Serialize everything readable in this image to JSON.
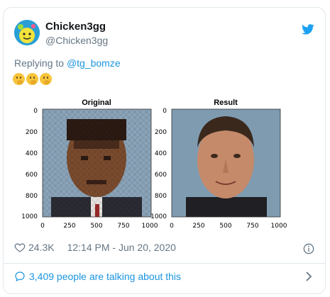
{
  "user": {
    "name": "Chicken3gg",
    "handle": "@Chicken3gg"
  },
  "reply": {
    "prefix": "Replying to ",
    "target": "@tg_bomze"
  },
  "emoji_count": 3,
  "figure": {
    "panels": [
      {
        "title": "Original",
        "xticks": [
          "0",
          "250",
          "500",
          "750",
          "1000"
        ],
        "yticks": [
          "0",
          "200",
          "400",
          "600",
          "800",
          "1000"
        ]
      },
      {
        "title": "Result",
        "xticks": [
          "0",
          "250",
          "500",
          "750",
          "1000"
        ],
        "yticks": [
          "0",
          "200",
          "400",
          "600",
          "800",
          "1000"
        ]
      }
    ]
  },
  "stats": {
    "likes": "24.3K",
    "timestamp": "12:14 PM - Jun 20, 2020"
  },
  "footer": {
    "talk_text": "3,409 people are talking about this"
  },
  "colors": {
    "twitter_blue": "#1b95e0",
    "text_secondary": "#657786",
    "border": "#e1e8ed"
  },
  "icons": [
    "twitter-bird-icon",
    "heart-icon",
    "info-icon",
    "comment-bubble-icon",
    "chevron-right-icon",
    "thinking-face-emoji"
  ]
}
